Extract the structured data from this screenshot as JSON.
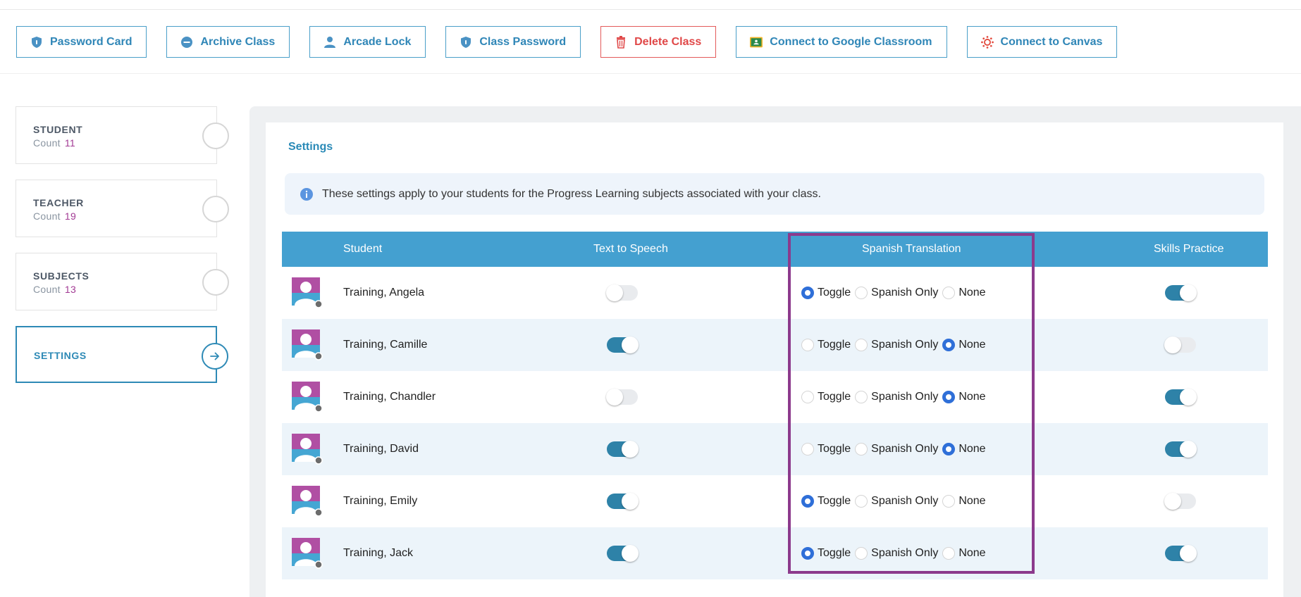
{
  "toolbar": [
    {
      "label": "Password Card",
      "icon": "shield-icon",
      "style": "normal"
    },
    {
      "label": "Archive Class",
      "icon": "minus-circle-icon",
      "style": "normal"
    },
    {
      "label": "Arcade Lock",
      "icon": "user-icon",
      "style": "normal"
    },
    {
      "label": "Class Password",
      "icon": "shield-icon",
      "style": "normal"
    },
    {
      "label": "Delete Class",
      "icon": "trash-icon",
      "style": "danger"
    },
    {
      "label": "Connect to Google Classroom",
      "icon": "google-classroom-icon",
      "style": "normal"
    },
    {
      "label": "Connect to Canvas",
      "icon": "canvas-icon",
      "style": "normal"
    }
  ],
  "sidebar": {
    "cards": [
      {
        "title": "STUDENT",
        "count_label": "Count",
        "count": "11"
      },
      {
        "title": "TEACHER",
        "count_label": "Count",
        "count": "19"
      },
      {
        "title": "SUBJECTS",
        "count_label": "Count",
        "count": "13"
      }
    ],
    "active": {
      "title": "SETTINGS"
    }
  },
  "main": {
    "title": "Settings",
    "info": "These settings apply to your students for the Progress Learning subjects associated with your class.",
    "columns": {
      "student": "Student",
      "tts": "Text to Speech",
      "spanish": "Spanish Translation",
      "skills": "Skills Practice"
    },
    "radio_labels": [
      "Toggle",
      "Spanish Only",
      "None"
    ],
    "students": [
      {
        "name": "Training, Angela",
        "tts": false,
        "spanish": "Toggle",
        "skills": true
      },
      {
        "name": "Training, Camille",
        "tts": true,
        "spanish": "None",
        "skills": false
      },
      {
        "name": "Training, Chandler",
        "tts": false,
        "spanish": "None",
        "skills": true
      },
      {
        "name": "Training, David",
        "tts": true,
        "spanish": "None",
        "skills": true
      },
      {
        "name": "Training, Emily",
        "tts": true,
        "spanish": "Toggle",
        "skills": false
      },
      {
        "name": "Training, Jack",
        "tts": true,
        "spanish": "Toggle",
        "skills": true
      }
    ]
  },
  "colors": {
    "accent": "#2e8ab6",
    "header": "#44a0d0",
    "danger": "#e04848",
    "highlight": "#8c3a8c",
    "count": "#a23a94"
  }
}
